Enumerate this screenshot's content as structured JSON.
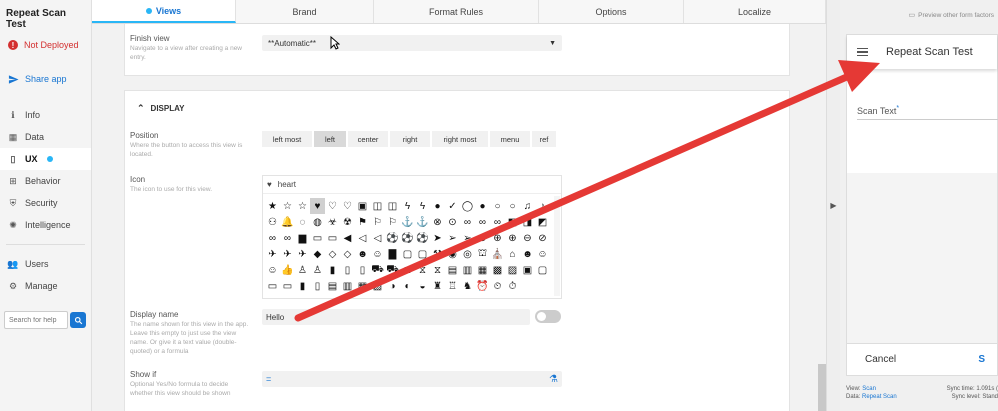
{
  "app": {
    "title": "Repeat Scan Test",
    "status": "Not Deployed",
    "share": "Share app"
  },
  "sidebar": {
    "items": [
      {
        "label": "Info",
        "icon": "info-icon"
      },
      {
        "label": "Data",
        "icon": "grid-icon"
      },
      {
        "label": "UX",
        "icon": "phone-icon",
        "active": true
      },
      {
        "label": "Behavior",
        "icon": "network-icon"
      },
      {
        "label": "Security",
        "icon": "shield-icon"
      },
      {
        "label": "Intelligence",
        "icon": "bulb-icon"
      }
    ],
    "items2": [
      {
        "label": "Users",
        "icon": "users-icon"
      },
      {
        "label": "Manage",
        "icon": "gear-icon"
      }
    ],
    "search_placeholder": "Search for help"
  },
  "tabs": [
    {
      "label": "Views",
      "active": true
    },
    {
      "label": "Brand"
    },
    {
      "label": "Format Rules"
    },
    {
      "label": "Options"
    },
    {
      "label": "Localize"
    }
  ],
  "finish_view": {
    "label": "Finish view",
    "desc": "Navigate to a view after creating a new entry.",
    "value": "**Automatic**"
  },
  "display": {
    "heading": "DISPLAY",
    "position": {
      "label": "Position",
      "desc": "Where the button to access this view is located.",
      "options": [
        "left most",
        "left",
        "center",
        "right",
        "right most",
        "menu",
        "ref"
      ],
      "selected": "left"
    },
    "icon": {
      "label": "Icon",
      "desc": "The icon to use for this view.",
      "value": "heart"
    },
    "display_name": {
      "label": "Display name",
      "desc": "The name shown for this view in the app. Leave this empty to just use the view name. Or give it a text value (double-quoted) or a formula",
      "value": "Hello"
    },
    "show_if": {
      "label": "Show if",
      "desc": "Optional Yes/No formula to decide whether this view should be shown",
      "value": "="
    }
  },
  "preview": {
    "top_link": "Preview other form factors",
    "title": "Repeat Scan Test",
    "field_label": "Scan Text",
    "cancel": "Cancel",
    "save": "S",
    "view_label": "View:",
    "view_value": "Scan",
    "data_label": "Data:",
    "data_value": "Repeat Scan",
    "sync_time_label": "Sync time:",
    "sync_time_value": "1.091s (",
    "sync_level_label": "Sync level:",
    "sync_level_value": "Stand"
  },
  "colors": {
    "accent": "#1976d2",
    "live": "#29b6f6",
    "error": "#d32f2f",
    "arrow": "#e53935"
  }
}
